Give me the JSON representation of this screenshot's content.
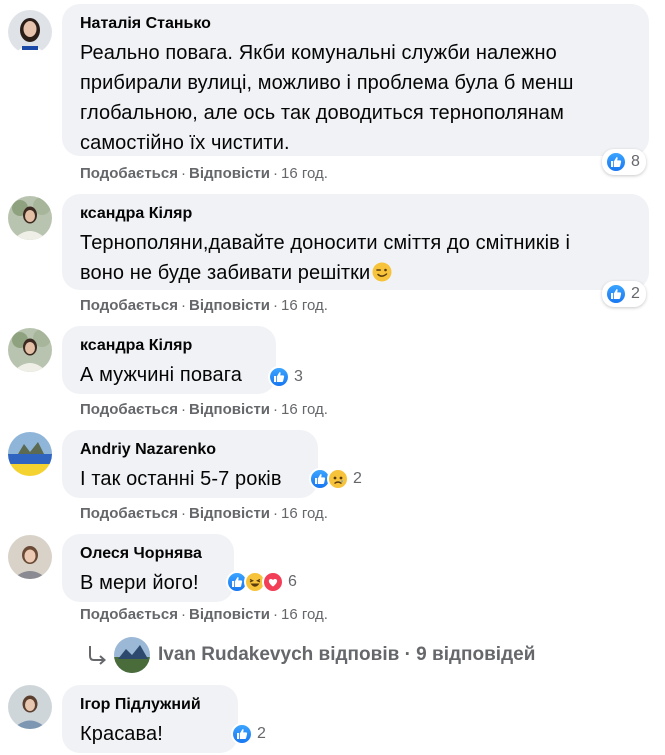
{
  "comments": [
    {
      "author": "Наталія Станько",
      "lines": [
        "Реально повага. Якби комунальні служби належно",
        "прибирали вулиці, можливо і проблема була б менш",
        "глобальною, але ось так доводиться тернополянам",
        "самостійно їх чистити."
      ],
      "reactions": [
        "like"
      ],
      "reaction_count": "8",
      "like_label": "Подобається",
      "reply_label": "Відповісти",
      "time": "16 год."
    },
    {
      "author": "ксандра Кіляр",
      "lines": [
        "Тернополяни,давайте доносити сміття до смітників і",
        "воно не буде забивати решітки"
      ],
      "emoji_after_text": "wink",
      "reactions": [
        "like"
      ],
      "reaction_count": "2",
      "like_label": "Подобається",
      "reply_label": "Відповісти",
      "time": "16 год."
    },
    {
      "author": "ксандра Кіляр",
      "lines": [
        "А мужчині повага"
      ],
      "reactions": [
        "like"
      ],
      "reaction_count": "3",
      "like_label": "Подобається",
      "reply_label": "Відповісти",
      "time": "16 год."
    },
    {
      "author": "Andriy Nazarenko",
      "lines": [
        "І так останні 5-7 років"
      ],
      "reactions": [
        "like",
        "sad"
      ],
      "reaction_count": "2",
      "like_label": "Подобається",
      "reply_label": "Відповісти",
      "time": "16 год."
    },
    {
      "author": "Олеся Чорнява",
      "lines": [
        "В мери його!"
      ],
      "reactions": [
        "like",
        "haha",
        "love"
      ],
      "reaction_count": "6",
      "like_label": "Подобається",
      "reply_label": "Відповісти",
      "time": "16 год."
    },
    {
      "author": "Ігор Підлужний",
      "lines": [
        "Красава!"
      ],
      "reactions": [
        "like"
      ],
      "reaction_count": "2"
    }
  ],
  "replies_bar": {
    "author": "Ivan Rudakevych",
    "verb": "відповів",
    "separator": "·",
    "count_text": "9 відповідей"
  },
  "colors": {
    "bubble": "#f0f2f5",
    "meta": "#65676b",
    "like": "#1877f2"
  },
  "icons": {
    "like": "thumbs-up-icon",
    "sad": "sad-face-icon",
    "haha": "laughing-face-icon",
    "love": "heart-icon",
    "reply": "reply-arrow-icon"
  }
}
